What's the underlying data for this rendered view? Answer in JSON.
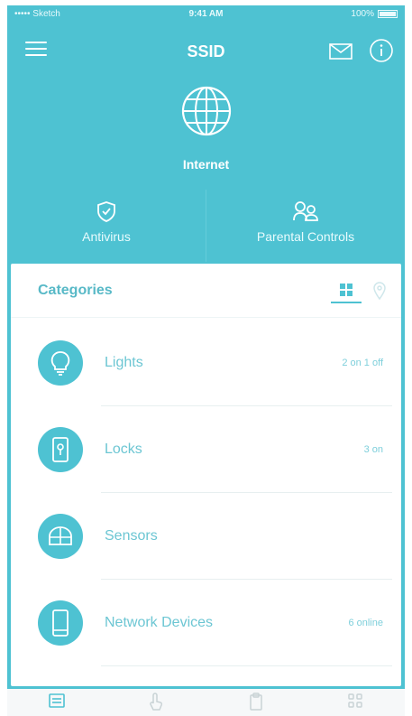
{
  "status_bar": {
    "carrier": "••••• Sketch",
    "time": "9:41 AM",
    "battery": "100%"
  },
  "header": {
    "title": "SSID"
  },
  "internet": {
    "label": "Internet"
  },
  "features": [
    {
      "label": "Antivirus",
      "icon": "shield-icon"
    },
    {
      "label": "Parental Controls",
      "icon": "people-icon"
    }
  ],
  "categories": {
    "title": "Categories",
    "items": [
      {
        "name": "Lights",
        "status": "2 on 1 off",
        "icon": "lightbulb-icon"
      },
      {
        "name": "Locks",
        "status": "3 on",
        "icon": "lock-icon"
      },
      {
        "name": "Sensors",
        "status": "",
        "icon": "sensor-icon"
      },
      {
        "name": "Network Devices",
        "status": "6 online",
        "icon": "phone-icon"
      }
    ]
  },
  "tabs": [
    {
      "icon": "devices-tab-icon",
      "active": true
    },
    {
      "icon": "automation-tab-icon",
      "active": false
    },
    {
      "icon": "clipboard-tab-icon",
      "active": false
    },
    {
      "icon": "more-tab-icon",
      "active": false
    }
  ],
  "colors": {
    "primary": "#4ec2d2",
    "white": "#ffffff",
    "accent_text": "#58b9c7"
  }
}
